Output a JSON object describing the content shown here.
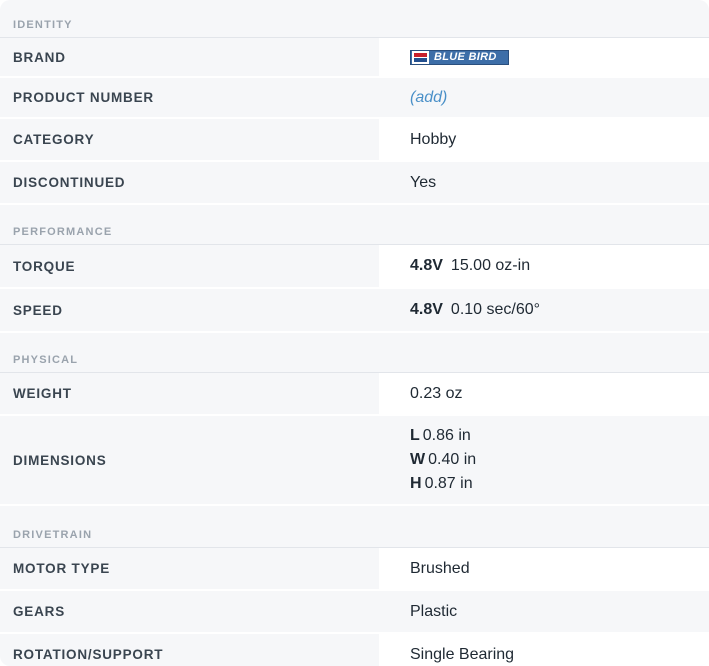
{
  "sections": {
    "identity": {
      "title": "IDENTITY",
      "brand": {
        "label": "BRAND",
        "logo_text": "BLUE BIRD",
        "logo_color": "#3d6ea8"
      },
      "product_number": {
        "label": "PRODUCT NUMBER",
        "value": "(add)"
      },
      "category": {
        "label": "CATEGORY",
        "value": "Hobby"
      },
      "discontinued": {
        "label": "DISCONTINUED",
        "value": "Yes"
      }
    },
    "performance": {
      "title": "PERFORMANCE",
      "torque": {
        "label": "TORQUE",
        "voltage": "4.8V",
        "value": "15.00 oz-in"
      },
      "speed": {
        "label": "SPEED",
        "voltage": "4.8V",
        "value": "0.10 sec/60°"
      }
    },
    "physical": {
      "title": "PHYSICAL",
      "weight": {
        "label": "WEIGHT",
        "value": "0.23 oz"
      },
      "dimensions": {
        "label": "DIMENSIONS",
        "l_key": "L",
        "l_value": "0.86 in",
        "w_key": "W",
        "w_value": "0.40 in",
        "h_key": "H",
        "h_value": "0.87 in"
      }
    },
    "drivetrain": {
      "title": "DRIVETRAIN",
      "motor_type": {
        "label": "MOTOR TYPE",
        "value": "Brushed"
      },
      "gears": {
        "label": "GEARS",
        "value": "Plastic"
      },
      "rotation": {
        "label": "ROTATION/SUPPORT",
        "value": "Single Bearing"
      }
    }
  },
  "colors": {
    "link": "#4a90c8",
    "section_title": "#9aa3ad",
    "label": "#3a4550"
  }
}
